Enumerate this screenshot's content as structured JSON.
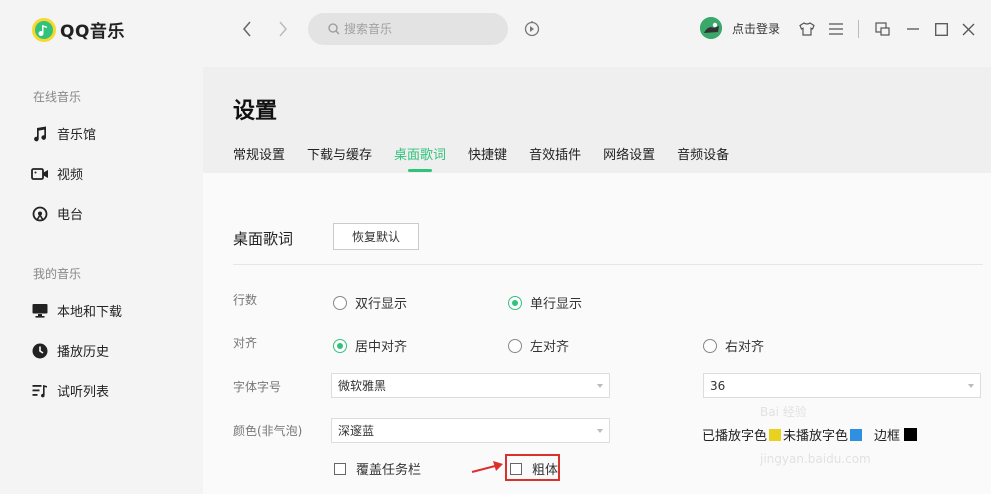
{
  "app": {
    "name": "QQ音乐"
  },
  "sidebar": {
    "section_online": "在线音乐",
    "online_items": [
      {
        "label": "音乐馆",
        "icon": "music-note-icon"
      },
      {
        "label": "视频",
        "icon": "video-icon"
      },
      {
        "label": "电台",
        "icon": "radio-icon"
      }
    ],
    "section_mine": "我的音乐",
    "mine_items": [
      {
        "label": "本地和下载",
        "icon": "monitor-icon"
      },
      {
        "label": "播放历史",
        "icon": "clock-icon"
      },
      {
        "label": "试听列表",
        "icon": "playlist-icon"
      }
    ]
  },
  "header": {
    "search_placeholder": "搜索音乐",
    "login_label": "点击登录"
  },
  "settings": {
    "title": "设置",
    "tabs": [
      "常规设置",
      "下载与缓存",
      "桌面歌词",
      "快捷键",
      "音效插件",
      "网络设置",
      "音频设备"
    ],
    "active_tab": "桌面歌词",
    "section": "桌面歌词",
    "restore_label": "恢复默认",
    "rows": {
      "lines_label": "行数",
      "lines_opt1": "双行显示",
      "lines_opt2": "单行显示",
      "align_label": "对齐",
      "align_opt1": "居中对齐",
      "align_opt2": "左对齐",
      "align_opt3": "右对齐",
      "font_label": "字体字号",
      "font_value": "微软雅黑",
      "size_value": "36",
      "color_label": "颜色(非气泡)",
      "color_value": "深邃蓝",
      "color_played": "已播放字色",
      "color_unplayed": "未播放字色",
      "color_border": "边框"
    },
    "cover_taskbar": "覆盖任务栏",
    "bold": "粗体"
  },
  "colors": {
    "accent": "#31c27c",
    "highlight": "#d9322d"
  },
  "watermark": {
    "text": "Bai 经验",
    "sub": "jingyan.baidu.com"
  }
}
